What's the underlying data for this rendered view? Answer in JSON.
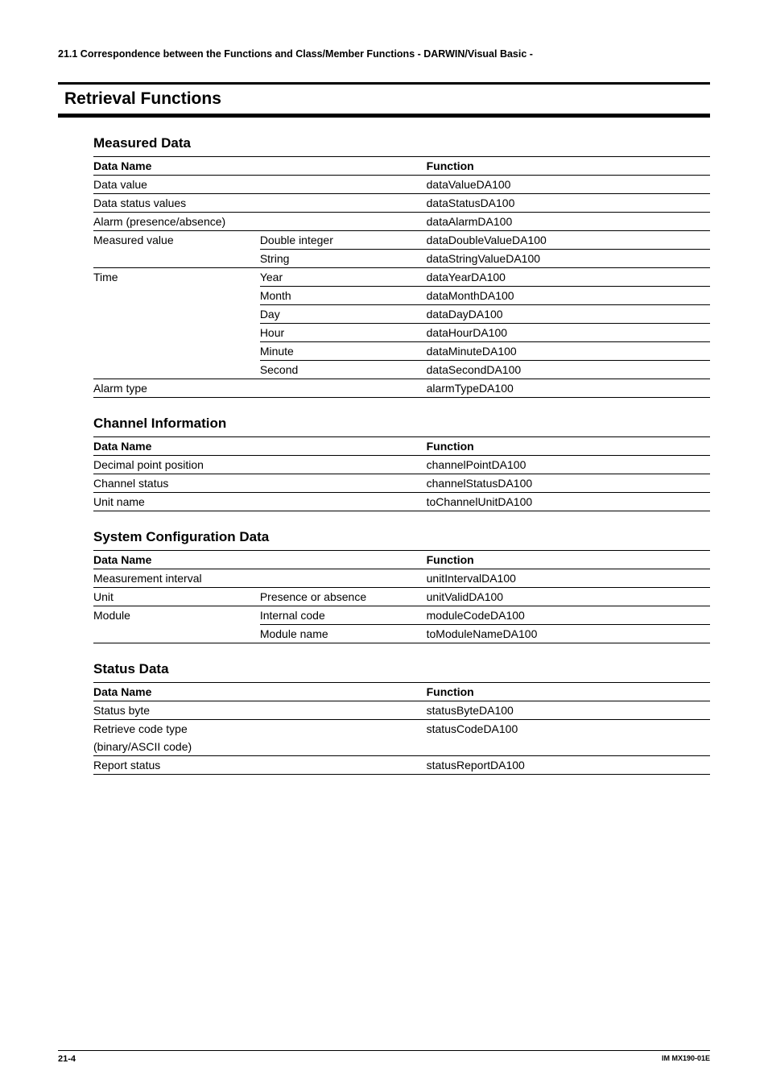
{
  "top_header": "21.1  Correspondence between the Functions and  Class/Member Functions - DARWIN/Visual Basic -",
  "section_title": "Retrieval Functions",
  "headers": {
    "data_name": "Data Name",
    "function": "Function"
  },
  "measured": {
    "title": "Measured Data",
    "rows": [
      {
        "c1": "Data value",
        "c2": "",
        "fn": "dataValueDA100",
        "span": true
      },
      {
        "c1": "Data status values",
        "c2": "",
        "fn": "dataStatusDA100",
        "span": true
      },
      {
        "c1": "Alarm (presence/absence)",
        "c2": "",
        "fn": "dataAlarmDA100",
        "span": true
      },
      {
        "c1": "Measured value",
        "c2": "Double integer",
        "fn": "dataDoubleValueDA100",
        "c1nob": true
      },
      {
        "c1": "",
        "c2": "String",
        "fn": "dataStringValueDA100"
      },
      {
        "c1": "Time",
        "c2": "Year",
        "fn": "dataYearDA100",
        "c1nob": true
      },
      {
        "c1": "",
        "c2": "Month",
        "fn": "dataMonthDA100",
        "c1nob": true
      },
      {
        "c1": "",
        "c2": "Day",
        "fn": "dataDayDA100",
        "c1nob": true
      },
      {
        "c1": "",
        "c2": "Hour",
        "fn": "dataHourDA100",
        "c1nob": true
      },
      {
        "c1": "",
        "c2": "Minute",
        "fn": "dataMinuteDA100",
        "c1nob": true
      },
      {
        "c1": "",
        "c2": "Second",
        "fn": "dataSecondDA100"
      },
      {
        "c1": "Alarm type",
        "c2": "",
        "fn": "alarmTypeDA100",
        "span": true
      }
    ]
  },
  "channel": {
    "title": "Channel Information",
    "rows": [
      {
        "name": "Decimal point position",
        "fn": "channelPointDA100"
      },
      {
        "name": "Channel status",
        "fn": "channelStatusDA100"
      },
      {
        "name": "Unit name",
        "fn": "toChannelUnitDA100"
      }
    ]
  },
  "sysconfig": {
    "title": "System Configuration Data",
    "rows": [
      {
        "c1": "Measurement interval",
        "c2": "",
        "fn": "unitIntervalDA100",
        "span": true
      },
      {
        "c1": "Unit",
        "c2": "Presence or absence",
        "fn": "unitValidDA100"
      },
      {
        "c1": "Module",
        "c2": "Internal code",
        "fn": "moduleCodeDA100",
        "c1nob": true
      },
      {
        "c1": "",
        "c2": "Module name",
        "fn": "toModuleNameDA100"
      }
    ]
  },
  "status": {
    "title": "Status Data",
    "rows": [
      {
        "name": "Status byte",
        "fn": "statusByteDA100"
      },
      {
        "name": "Retrieve code type",
        "fn": "statusCodeDA100",
        "nob": true
      },
      {
        "name": "(binary/ASCII code)",
        "fn": ""
      },
      {
        "name": "Report status",
        "fn": "statusReportDA100"
      }
    ]
  },
  "footer": {
    "page": "21-4",
    "code": "IM MX190-01E"
  }
}
